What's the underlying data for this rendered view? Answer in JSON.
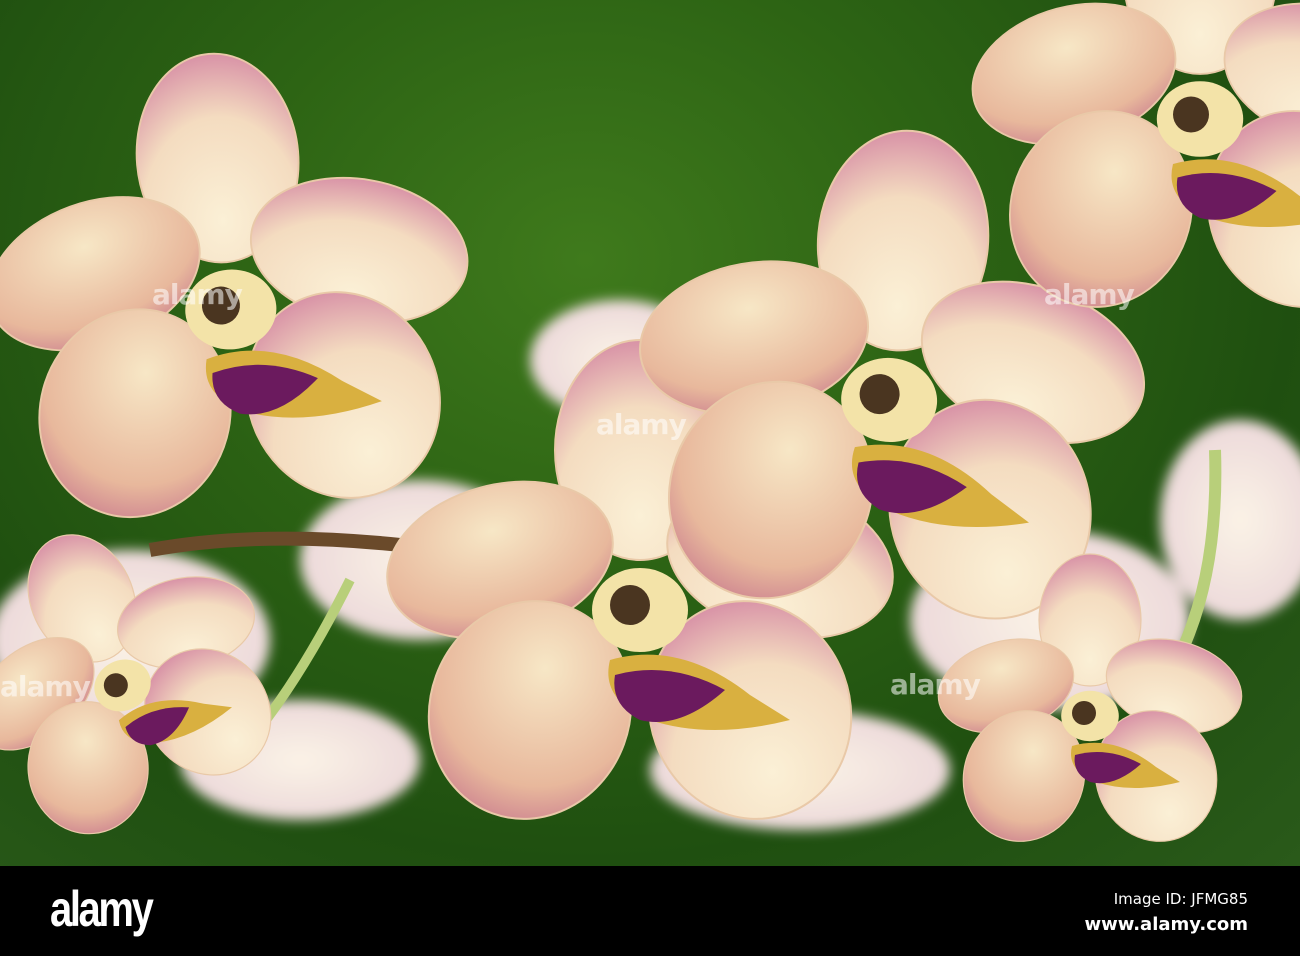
{
  "photo": {
    "subject": "orchid-flowers",
    "watermark_text": "alamy",
    "colors": {
      "background": "#2d6414",
      "petal": "#f6e6c8",
      "blush": "#c9608f",
      "lip": "#6b1a5e",
      "column": "#e8c84a"
    }
  },
  "footer": {
    "logo": "alamy",
    "image_id": "Image ID: JFMG85",
    "website": "www.alamy.com"
  }
}
